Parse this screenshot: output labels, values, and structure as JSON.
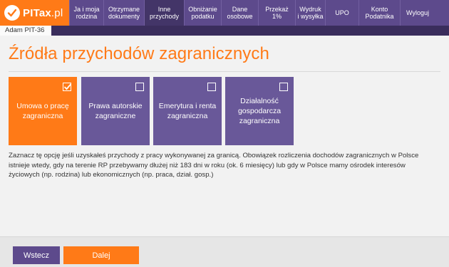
{
  "brand": {
    "name": "PITax",
    "suffix": ".pl"
  },
  "nav": [
    {
      "label": "Ja i moja\nrodzina",
      "w": 48
    },
    {
      "label": "Otrzymane\ndokumenty",
      "w": 57
    },
    {
      "label": "Inne\nprzychody",
      "w": 56,
      "active": true
    },
    {
      "label": "Obniżanie\npodatku",
      "w": 52
    },
    {
      "label": "Dane\nosobowe",
      "w": 52
    },
    {
      "label": "Przekaż\n1%",
      "w": 52
    },
    {
      "label": "Wydruk\ni wysyłka",
      "w": 42
    },
    {
      "label": "UPO",
      "w": 47
    },
    {
      "label": "Konto\nPodatnika",
      "w": 58
    },
    {
      "label": "Wyloguj",
      "w": 49
    }
  ],
  "user_tab": "Adam PIT-36",
  "page_title": "Źródła przychodów zagranicznych",
  "tiles": [
    {
      "label": "Umowa o pracę\nzagraniczna",
      "checked": true
    },
    {
      "label": "Prawa autorskie\nzagraniczne",
      "checked": false
    },
    {
      "label": "Emerytura i renta\nzagraniczna",
      "checked": false
    },
    {
      "label": "Działalność\ngospodarcza\nzagraniczna",
      "checked": false
    }
  ],
  "description": "Zaznacz tę opcję jeśli uzyskałeś przychody z pracy wykonywanej za granicą. Obowiązek rozliczenia dochodów zagranicznych w Polsce istnieje wtedy, gdy na terenie RP przebywamy dłużej niż 183 dni w roku (ok. 6 miesięcy) lub gdy w Polsce mamy ośrodek interesów życiowych (np. rodzina) lub ekonomicznych (np. praca, dział. gosp.)",
  "buttons": {
    "back": "Wstecz",
    "next": "Dalej"
  },
  "colors": {
    "accent": "#ff7a17",
    "brand": "#5d4a8c",
    "tile": "#695899"
  }
}
